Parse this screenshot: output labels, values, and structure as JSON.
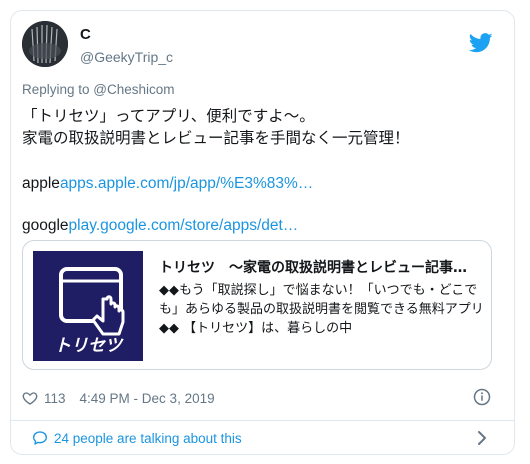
{
  "author": {
    "display_name": "C",
    "handle": "@GeekyTrip_c",
    "avatar_icon": "avatar-icon"
  },
  "reply": {
    "prefix": "Replying to ",
    "mention": "@Cheshicom"
  },
  "body": {
    "line1": "「トリセツ」ってアプリ、便利ですよ〜。",
    "line2": "家電の取扱説明書とレビュー記事を手間なく一元管理！",
    "apple_label": "apple",
    "apple_link": "apps.apple.com/jp/app/%E3%83%…",
    "google_label": "google",
    "google_link": "play.google.com/store/apps/det…"
  },
  "preview": {
    "logo_text": "トリセツ",
    "title": "トリセツ　～家電の取扱説明書とレビュー記事…",
    "description": "◆◆もう「取説探し」で悩まない！「いつでも・どこでも」あらゆる製品の取扱説明書を閲覧できる無料アプリ◆◆ 【トリセツ】は、暮らしの中"
  },
  "meta": {
    "likes": "113",
    "timestamp": "4:49 PM - Dec 3, 2019"
  },
  "footer": {
    "talking": "24 people are talking about this"
  },
  "colors": {
    "accent": "#1b95e0",
    "twitter_blue": "#1da1f2",
    "secondary_text": "#657786",
    "thumb_bg": "#1f1d63"
  }
}
